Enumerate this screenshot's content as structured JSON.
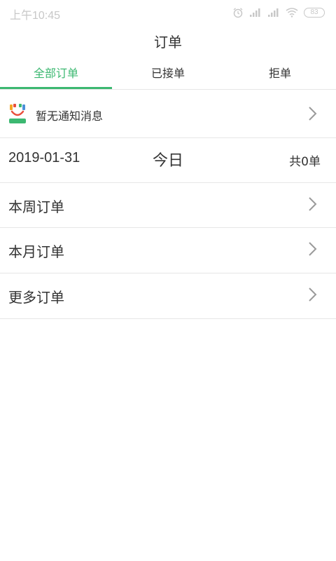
{
  "status_bar": {
    "time": "上午10:45",
    "battery": "83"
  },
  "header": {
    "title": "订单"
  },
  "tabs": [
    {
      "label": "全部订单",
      "active": true
    },
    {
      "label": "已接单",
      "active": false
    },
    {
      "label": "拒单",
      "active": false
    }
  ],
  "notice": {
    "text": "暂无通知消息",
    "icon": "app-logo-icon"
  },
  "today_row": {
    "date": "2019-01-31",
    "label": "今日",
    "count": "共0单"
  },
  "menu": {
    "week": "本周订单",
    "month": "本月订单",
    "more": "更多订单"
  },
  "colors": {
    "accent": "#3cb871",
    "divider": "#e6e6e6",
    "text": "#333333"
  }
}
